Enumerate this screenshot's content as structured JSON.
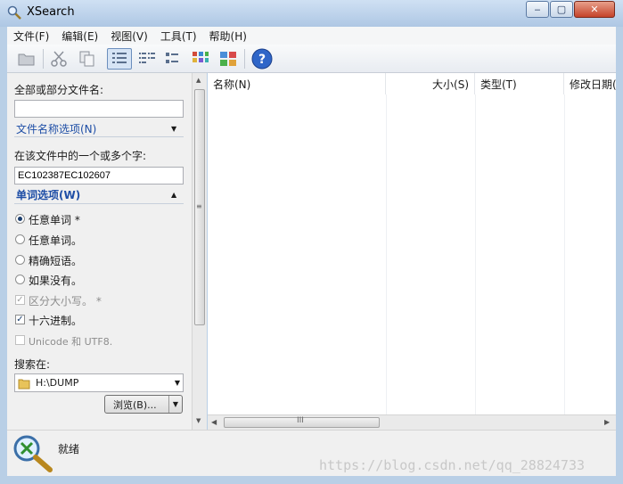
{
  "window": {
    "title": "XSearch",
    "controls": [
      "‒",
      "▢",
      "✕"
    ]
  },
  "menu": [
    "文件(F)",
    "编辑(E)",
    "视图(V)",
    "工具(T)",
    "帮助(H)"
  ],
  "left": {
    "filename_label": "全部或部分文件名:",
    "filename_value": "",
    "filename_options": "文件名称选项(N)",
    "words_label": "在该文件中的一个或多个字:",
    "words_value": "EC102387EC102607",
    "word_options": "单词选项(W)",
    "options": [
      {
        "label": "任意单词 *",
        "type": "radio",
        "checked": true,
        "enabled": true
      },
      {
        "label": "任意单词。",
        "type": "radio",
        "checked": false,
        "enabled": true
      },
      {
        "label": "精确短语。",
        "type": "radio",
        "checked": false,
        "enabled": true
      },
      {
        "label": "如果没有。",
        "type": "radio",
        "checked": false,
        "enabled": true
      },
      {
        "label": "区分大小写。 *",
        "type": "check",
        "checked": true,
        "enabled": false
      },
      {
        "label": "十六进制。",
        "type": "check",
        "checked": true,
        "enabled": true
      },
      {
        "label": "Unicode 和 UTF8.",
        "type": "check",
        "checked": false,
        "enabled": false
      }
    ],
    "search_in_label": "搜索在:",
    "search_in_value": "H:\\DUMP",
    "browse_label": "浏览(B)..."
  },
  "results": {
    "columns": [
      "名称(N)",
      "大小(S)",
      "类型(T)",
      "修改日期("
    ]
  },
  "status": {
    "text": "就绪"
  },
  "watermark": "https://blog.csdn.net/qq_28824733",
  "colors": {
    "frame": "#b9cfe6",
    "link": "#1e4ea6",
    "panel": "#f0f0f0"
  }
}
